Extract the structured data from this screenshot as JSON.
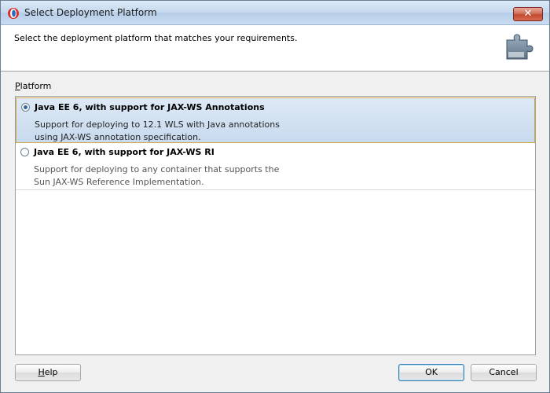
{
  "window": {
    "title": "Select Deployment Platform"
  },
  "header": {
    "text": "Select the deployment platform that matches your requirements."
  },
  "platform": {
    "label_first": "P",
    "label_rest": "latform",
    "options": [
      {
        "title": "Java EE 6, with support for JAX-WS Annotations",
        "desc_line1": "Support for deploying to 12.1 WLS with Java annotations",
        "desc_line2": "using JAX-WS annotation specification.",
        "selected": true
      },
      {
        "title": "Java EE 6, with support for JAX-WS RI",
        "desc_line1": "Support for deploying to any container that supports the",
        "desc_line2": "Sun JAX-WS Reference Implementation.",
        "selected": false
      }
    ]
  },
  "buttons": {
    "help_first": "H",
    "help_rest": "elp",
    "ok": "OK",
    "cancel": "Cancel",
    "close": "✕"
  },
  "icons": {
    "app": "oracle-app-icon",
    "header": "puzzle-piece-icon",
    "close": "close-icon"
  },
  "colors": {
    "selection_border": "#d1a94a",
    "close_button": "#c24a32"
  }
}
